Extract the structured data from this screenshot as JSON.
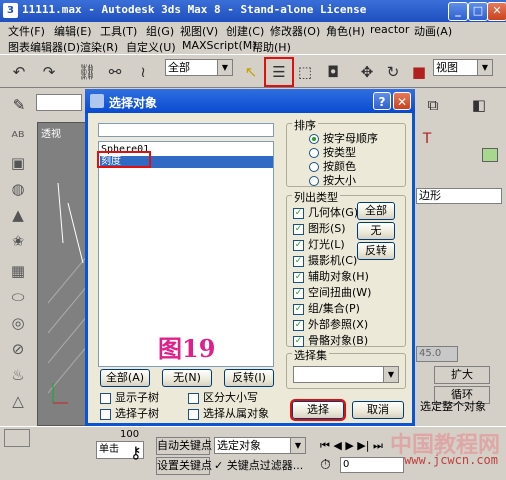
{
  "app": {
    "title": "11111.max - Autodesk 3ds Max 8  - Stand-alone License",
    "window_buttons": {
      "minimize": "_",
      "maximize": "□",
      "close": "✕"
    }
  },
  "menubar1": [
    "文件(F)",
    "编辑(E)",
    "工具(T)",
    "组(G)",
    "视图(V)",
    "创建(C)",
    "修改器(O)",
    "角色(H)",
    "reactor",
    "动画(A)"
  ],
  "menubar2": [
    "图表编辑器(D)",
    "渲染(R)",
    "自定义(U)",
    "MAXScript(M)",
    "帮助(H)"
  ],
  "toolbar": {
    "selection_filter": "全部",
    "reference_coord": "视图"
  },
  "viewport": {
    "label": "透视"
  },
  "dialog": {
    "title": "选择对象",
    "help": "?",
    "close": "✕",
    "list_items": [
      "Sphere01",
      "刻度"
    ],
    "selected_index": 1,
    "sort": {
      "title": "排序",
      "options": [
        "按字母顺序",
        "按类型",
        "按颜色",
        "按大小"
      ],
      "selected": 0
    },
    "list_types": {
      "title": "列出类型",
      "items": [
        "几何体(G)",
        "图形(S)",
        "灯光(L)",
        "摄影机(C)",
        "辅助对象(H)",
        "空间扭曲(W)",
        "组/集合(P)",
        "外部参照(X)",
        "骨骼对象(B)"
      ],
      "btn_all": "全部",
      "btn_none": "无",
      "btn_invert": "反转"
    },
    "selection_set": {
      "title": "选择集",
      "value": ""
    },
    "bottom_buttons": {
      "all": "全部(A)",
      "none": "无(N)",
      "invert": "反转(I)"
    },
    "options": [
      "显示子树",
      "选择子树",
      "区分大小写",
      "选择从属对象"
    ],
    "select_button": "选择",
    "cancel_button": "取消",
    "annotation": "图19"
  },
  "right_panel": {
    "item": "边形",
    "value": "45.0",
    "buttons": [
      "扩大",
      "循环"
    ],
    "select_whole": "选定整个对象"
  },
  "bottom": {
    "auto_key": "自动关键点",
    "set_key": "设置关键点",
    "filter": "关键点过滤器...",
    "selected_obj": "选定对象",
    "single_click": "单击",
    "frame": "0",
    "coord_value": "100",
    "watermark": "中国教程网",
    "watermark_url": "www.jcwcn.com"
  },
  "colors": {
    "title_bar": "#1f4fbf",
    "highlight_red": "#e01010",
    "selection": "#316ac5",
    "annotation_pink": "#e0208a"
  }
}
